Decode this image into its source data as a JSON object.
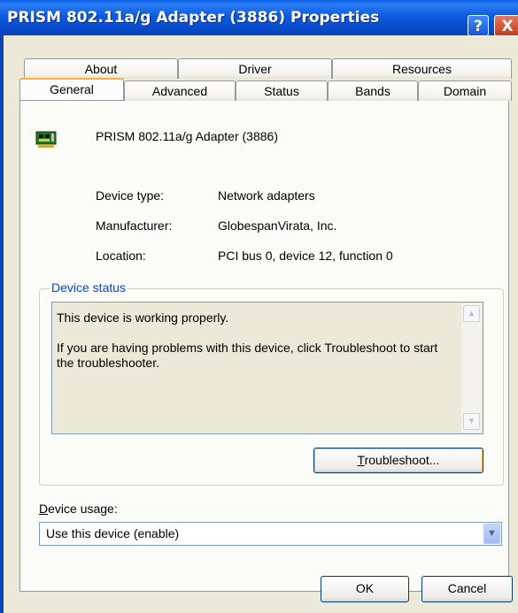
{
  "window": {
    "title": "PRISM 802.11a/g Adapter (3886) Properties"
  },
  "title_buttons": {
    "help": "?",
    "close": "X"
  },
  "tabs_back": [
    "About",
    "Driver",
    "Resources"
  ],
  "tabs_front": [
    "General",
    "Advanced",
    "Status",
    "Bands",
    "Domain"
  ],
  "device": {
    "name": "PRISM 802.11a/g Adapter (3886)",
    "icon": "network-adapter-card-icon"
  },
  "properties": {
    "type_label": "Device type:",
    "type_value": "Network adapters",
    "manufacturer_label": "Manufacturer:",
    "manufacturer_value": "GlobespanVirata, Inc.",
    "location_label": "Location:",
    "location_value": "PCI bus 0, device 12, function 0"
  },
  "device_status": {
    "title": "Device status",
    "line1": "This device is working properly.",
    "line2": "If you are having problems with this device, click Troubleshoot to start the troubleshooter.",
    "troubleshoot_mnemonic": "T",
    "troubleshoot_rest": "roubleshoot..."
  },
  "device_usage": {
    "label_mnemonic": "D",
    "label_rest": "evice usage:",
    "selected": "Use this device (enable)"
  },
  "buttons": {
    "ok": "OK",
    "cancel": "Cancel"
  },
  "colors": {
    "title_bar": "#0a5fe4",
    "accent_orange": "#f8b03c",
    "group_title": "#0046d5",
    "dialog_bg": "#ece9d8"
  }
}
